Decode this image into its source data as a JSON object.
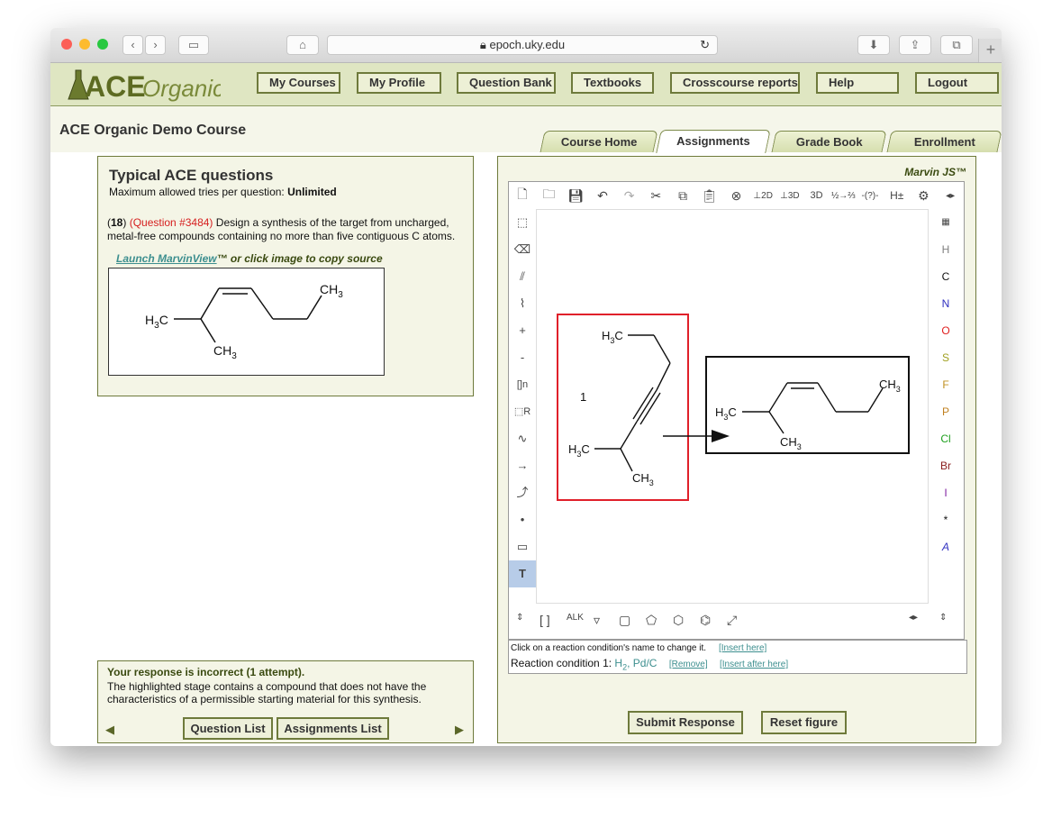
{
  "browser": {
    "url": "epoch.uky.edu",
    "reload_icon": "reload-icon",
    "plus_icon": "plus-icon"
  },
  "site": {
    "logo_text_ace": "ACE",
    "logo_text_organic": "Organic",
    "nav": [
      "My Courses",
      "My Profile",
      "Question Bank",
      "Textbooks",
      "Crosscourse reports",
      "Help",
      "Logout"
    ]
  },
  "course": {
    "title": "ACE Organic Demo Course",
    "tabs": [
      {
        "label": "Course Home",
        "active": false
      },
      {
        "label": "Assignments",
        "active": true
      },
      {
        "label": "Grade Book",
        "active": false
      },
      {
        "label": "Enrollment",
        "active": false
      }
    ]
  },
  "question": {
    "heading": "Typical ACE questions",
    "tries_label": "Maximum allowed tries per question:",
    "tries_value": "Unlimited",
    "number": "18",
    "qid": "(Question #3484)",
    "text": "Design a synthesis of the target from uncharged, metal-free compounds containing no more than five contiguous C atoms.",
    "launch_link": "Launch MarvinView",
    "launch_suffix": "™ or click image to copy source"
  },
  "response": {
    "heading": "Your response is incorrect (1 attempt).",
    "body": "The highlighted stage contains a compound that does not have the characteristics of a permissible starting material for this synthesis.",
    "question_list_button": "Question List",
    "assignments_list_button": "Assignments List"
  },
  "marvin": {
    "label": "Marvin JS™",
    "stage_label": "1",
    "elements": [
      {
        "symbol": "H",
        "color": "#808080"
      },
      {
        "symbol": "C",
        "color": "#111111"
      },
      {
        "symbol": "N",
        "color": "#3030c0"
      },
      {
        "symbol": "O",
        "color": "#e02020"
      },
      {
        "symbol": "S",
        "color": "#a0a020"
      },
      {
        "symbol": "F",
        "color": "#c09020"
      },
      {
        "symbol": "P",
        "color": "#c08020"
      },
      {
        "symbol": "Cl",
        "color": "#20a020"
      },
      {
        "symbol": "Br",
        "color": "#8a2020"
      },
      {
        "symbol": "I",
        "color": "#8020a0"
      },
      {
        "symbol": "*",
        "color": "#111111"
      },
      {
        "symbol": "A",
        "color": "#3030c0"
      }
    ],
    "reaction_hint": "Click on a reaction condition's name to change it.",
    "insert_here": "[Insert here]",
    "condition_label": "Reaction condition 1:",
    "condition_value_pre": "H",
    "condition_value_sub": "2",
    "condition_value_post": ", Pd/C",
    "remove": "[Remove]",
    "insert_after": "[Insert after here]",
    "submit_button": "Submit Response",
    "reset_button": "Reset figure"
  },
  "molecule_labels": {
    "h3c": "H",
    "c": "C",
    "ch": "CH",
    "three": "3"
  }
}
